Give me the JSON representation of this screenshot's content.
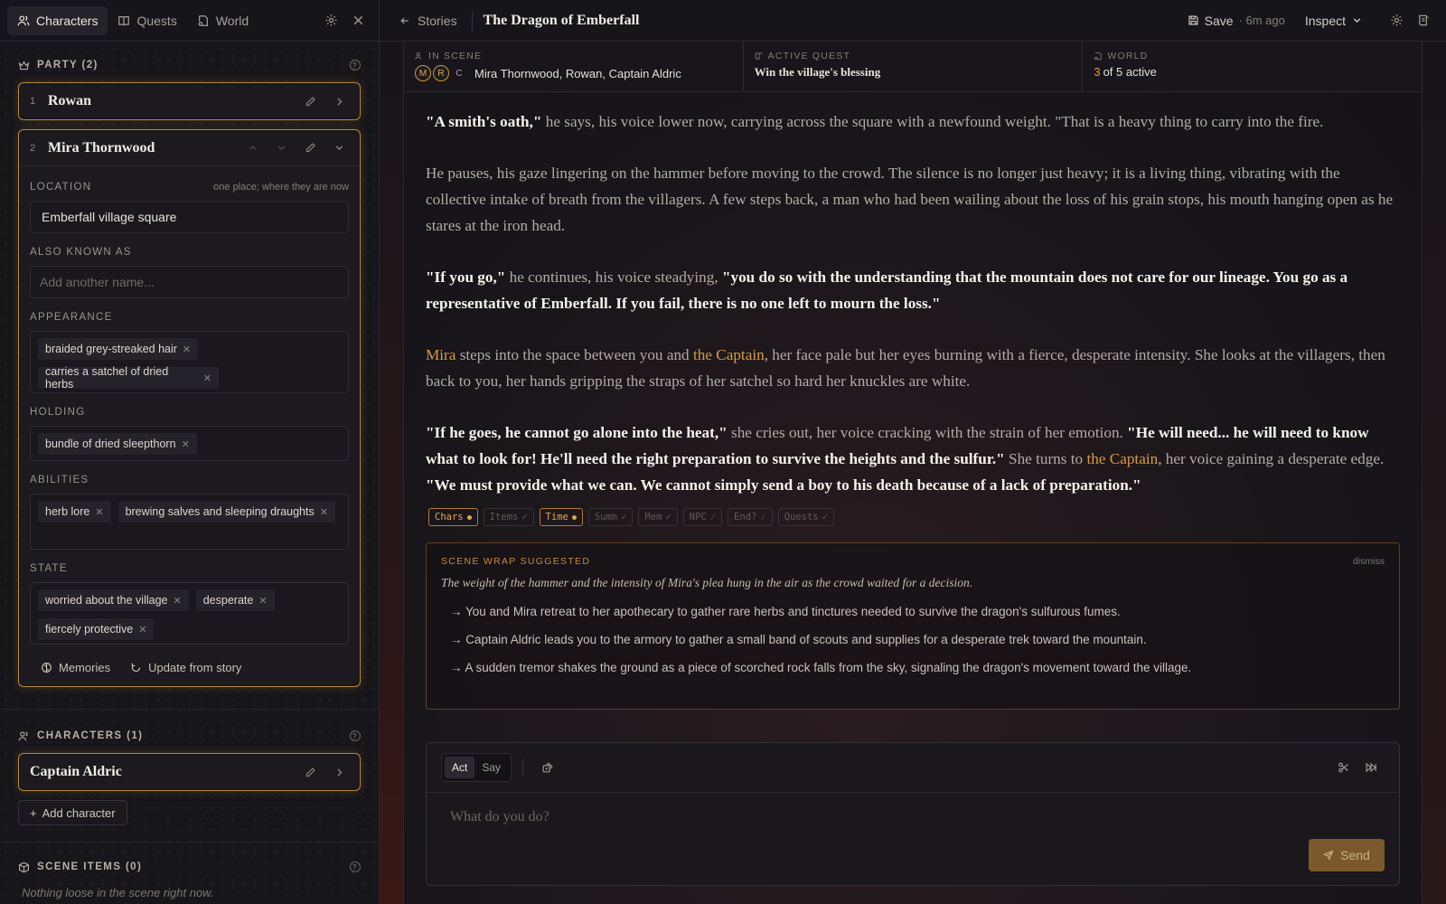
{
  "sidebar": {
    "tabs": [
      {
        "label": "Characters",
        "icon": "users-icon",
        "active": true
      },
      {
        "label": "Quests",
        "icon": "book-icon",
        "active": false
      },
      {
        "label": "World",
        "icon": "map-pin-icon",
        "active": false
      }
    ],
    "party": {
      "title": "PARTY (2)",
      "members": [
        {
          "num": "1",
          "name": "Rowan"
        },
        {
          "num": "2",
          "name": "Mira Thornwood"
        }
      ],
      "expanded": {
        "location_label": "LOCATION",
        "location_hint": "one place; where they are now",
        "location_value": "Emberfall village square",
        "aka_label": "ALSO KNOWN AS",
        "aka_placeholder": "Add another name...",
        "appearance_label": "APPEARANCE",
        "appearance": [
          "braided grey-streaked hair",
          "carries a satchel of dried herbs"
        ],
        "holding_label": "HOLDING",
        "holding": [
          "bundle of dried sleepthorn"
        ],
        "abilities_label": "ABILITIES",
        "abilities": [
          "herb lore",
          "brewing salves and sleeping draughts"
        ],
        "state_label": "STATE",
        "state": [
          "worried about the village",
          "desperate",
          "fiercely protective"
        ],
        "memories_label": "Memories",
        "update_label": "Update from story"
      }
    },
    "characters": {
      "title": "CHARACTERS (1)",
      "items": [
        {
          "name": "Captain Aldric"
        }
      ],
      "add_label": "Add character"
    },
    "scene_items": {
      "title": "SCENE ITEMS (0)",
      "empty": "Nothing loose in the scene right now."
    }
  },
  "topbar": {
    "back_label": "Stories",
    "title": "The Dragon of Emberfall",
    "save_label": "Save",
    "save_time": "· 6m ago",
    "inspect_label": "Inspect"
  },
  "info": {
    "in_scene_label": "IN SCENE",
    "in_scene_avatars": [
      "M",
      "R",
      "C"
    ],
    "in_scene_value": "Mira Thornwood, Rowan, Captain Aldric",
    "quest_label": "ACTIVE QUEST",
    "quest_value": "Win the village's blessing",
    "world_label": "WORLD",
    "world_count": "3",
    "world_rest": "of 5 active"
  },
  "story": {
    "p1_b": "\"A smith's oath,\"",
    "p1_t": " he says, his voice lower now, carrying across the square with a newfound weight. \"That is a heavy thing to carry into the fire.",
    "p2": "He pauses, his gaze lingering on the hammer before moving to the crowd. The silence is no longer just heavy; it is a living thing, vibrating with the collective intake of breath from the villagers. A few steps back, a man who had been wailing about the loss of his grain stops, his mouth hanging open as he stares at the iron head.",
    "p3_b1": "\"If you go,\"",
    "p3_t": " he continues, his voice steadying, ",
    "p3_b2": "\"you do so with the understanding that the mountain does not care for our lineage. You go as a representative of Emberfall. If you fail, there is no one left to mourn the loss.\"",
    "p4_n1": "Mira",
    "p4_t1": " steps into the space between you and ",
    "p4_n2": "the Captain",
    "p4_t2": ", her face pale but her eyes burning with a fierce, desperate intensity. She looks at the villagers, then back to you, her hands gripping the straps of her satchel so hard her knuckles are white.",
    "p5_b1": "\"If he goes, he cannot go alone into the heat,\"",
    "p5_t1": " she cries out, her voice cracking with the strain of her emotion. ",
    "p5_b2": "\"He will need... he will need to know what to look for! He'll need the right preparation to survive the heights and the sulfur.\"",
    "p5_t2": " She turns to ",
    "p5_n": "the Captain",
    "p5_t3": ", her voice gaining a desperate edge. ",
    "p5_b3": "\"We must provide what we can. We cannot simply send a boy to his death because of a lack of preparation.\""
  },
  "tags": [
    {
      "label": "Chars",
      "mark": "●",
      "on": true
    },
    {
      "label": "Items",
      "mark": "✓",
      "on": false
    },
    {
      "label": "Time",
      "mark": "●",
      "on": true
    },
    {
      "label": "Summ",
      "mark": "✓",
      "on": false
    },
    {
      "label": "Mem",
      "mark": "✓",
      "on": false
    },
    {
      "label": "NPC",
      "mark": "⁄",
      "on": false
    },
    {
      "label": "End?",
      "mark": "⁄",
      "on": false
    },
    {
      "label": "Quests",
      "mark": "✓",
      "on": false
    }
  ],
  "scene_wrap": {
    "title": "SCENE WRAP SUGGESTED",
    "dismiss": "dismiss",
    "summary": "The weight of the hammer and the intensity of Mira's plea hung in the air as the crowd waited for a decision.",
    "options": [
      "→ You and Mira retreat to her apothecary to gather rare herbs and tinctures needed to survive the dragon's sulfurous fumes.",
      "→ Captain Aldric leads you to the armory to gather a small band of scouts and supplies for a desperate trek toward the mountain.",
      "→ A sudden tremor shakes the ground as a piece of scorched rock falls from the sky, signaling the dragon's movement toward the village."
    ]
  },
  "composer": {
    "mode_act": "Act",
    "mode_say": "Say",
    "placeholder": "What do you do?",
    "send_label": "Send"
  },
  "colors": {
    "accent": "#d89b3f",
    "card_border": "#b88a3a",
    "send_bg": "#7a5a2c"
  }
}
